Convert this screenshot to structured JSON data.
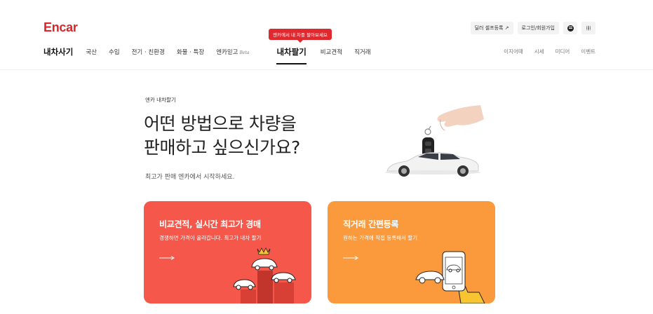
{
  "header": {
    "logo": "Encar",
    "tooltip": "엔카에서 내 차를 팔아보세요",
    "dealer_btn": "딜러 셀프등록 ↗",
    "login_btn": "로그인/회원가입",
    "nav": {
      "brand_tab": "내차사기",
      "items": [
        "국산",
        "수입",
        "전기 · 친환경",
        "화물 · 특장",
        "엔카믿고"
      ],
      "beta": "Beta",
      "active_tab": "내차팔기",
      "after_items": [
        "비교견적",
        "직거래"
      ]
    },
    "nav_right": [
      "이지어때",
      "시세",
      "미디어",
      "이벤트"
    ]
  },
  "hero": {
    "eyebrow": "엔카 내차팔기",
    "headline_line1": "어떤 방법으로 차량을",
    "headline_line2": "판매하고 싶으신가요?",
    "sub": "최고가 판매 엔카에서 시작하세요."
  },
  "cards": [
    {
      "title": "비교견적, 실시간 최고가 경매",
      "desc": "경쟁하면 가격이 올라갑니다. 최고가 내차 팔기",
      "color": "#f5584a"
    },
    {
      "title": "직거래 간편등록",
      "desc": "원하는 가격에 직접 등록해서 팔기",
      "color": "#fb9a3c"
    }
  ],
  "colors": {
    "brand": "#d8262b",
    "card_red": "#f5584a",
    "card_orange": "#fb9a3c"
  },
  "icons": [
    "chat-icon",
    "grid-menu-icon",
    "arrow-right-icon",
    "car-key-icon",
    "auction-cars-icon",
    "phone-hand-icon"
  ]
}
